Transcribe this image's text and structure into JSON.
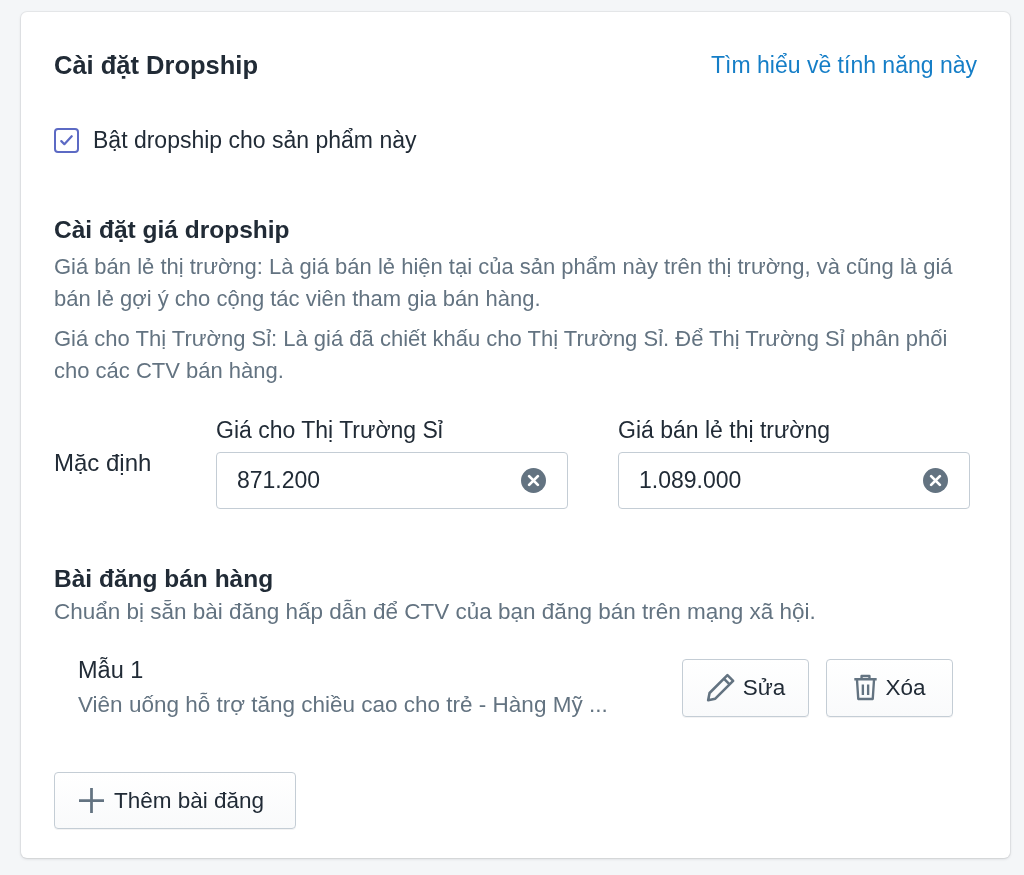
{
  "card": {
    "title": "Cài đặt Dropship",
    "help_link": "Tìm hiểu về tính năng này"
  },
  "enable_dropship": {
    "label": "Bật dropship cho sản phẩm này",
    "checked": true
  },
  "pricing": {
    "heading": "Cài đặt giá dropship",
    "descriptions": [
      "Giá bán lẻ thị trường: Là giá bán lẻ hiện tại của sản phẩm này trên thị trường, và cũng là giá bán lẻ gợi ý cho cộng tác viên tham gia bán hàng.",
      "Giá cho Thị Trường Sỉ: Là giá đã chiết khấu cho Thị Trường Sỉ. Để Thị Trường Sỉ phân phối cho các CTV bán hàng."
    ],
    "row_label": "Mặc định",
    "fields": [
      {
        "label": "Giá cho Thị Trường Sỉ",
        "value": "871.200"
      },
      {
        "label": "Giá bán lẻ thị trường",
        "value": "1.089.000"
      }
    ]
  },
  "posts": {
    "heading": "Bài đăng bán hàng",
    "description": "Chuẩn bị sẵn bài đăng hấp dẫn để CTV của bạn đăng bán trên mạng xã hội.",
    "templates": [
      {
        "name": "Mẫu 1",
        "summary": "Viên uống hỗ trợ tăng chiều cao cho trẻ - Hàng Mỹ ...",
        "actions": [
          {
            "kind": "edit",
            "label": "Sửa"
          },
          {
            "kind": "delete",
            "label": "Xóa"
          }
        ]
      }
    ],
    "add_button": "Thêm bài đăng"
  }
}
